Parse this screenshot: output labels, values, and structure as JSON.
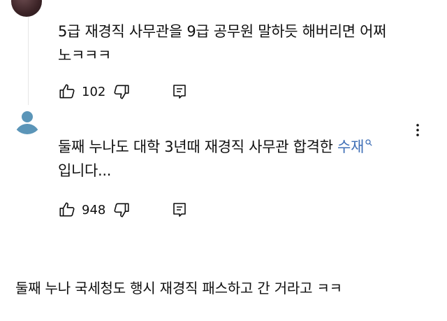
{
  "comments": [
    {
      "text_line1": "5급 재경직 사무관을 9급 공무원 말하듯 해버리면 어쩌",
      "text_line2": "노ㅋㅋㅋ",
      "like_count": "102"
    },
    {
      "text_before_mention": "둘째 누나도 대학 3년때 재경직 사무관 합격한 ",
      "mention": "수재",
      "text_line2": "입니다...",
      "like_count": "948"
    }
  ],
  "caption": "둘째 누나 국세청도 행시 재경직 패스하고 간 거라고 ㅋㅋ",
  "colors": {
    "text": "#0f0f0f",
    "mention": "#3f6fb6",
    "avatar_default": "#5b95b8",
    "thread_line": "#e6e6e6"
  },
  "icons": {
    "like": "thumb-up-icon",
    "dislike": "thumb-down-icon",
    "reply": "reply-icon",
    "more": "more-vert-icon",
    "mention_search": "search-icon"
  }
}
